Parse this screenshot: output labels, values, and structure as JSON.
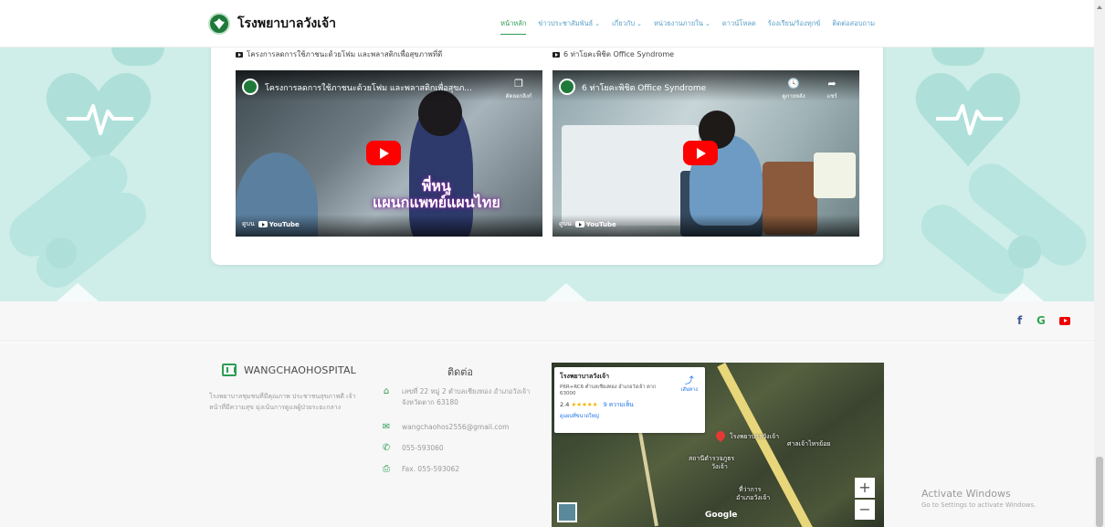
{
  "header": {
    "logo_text": "โรงพยาบาลวังเจ้า",
    "nav": [
      {
        "label": "หน้าหลัก",
        "active": true,
        "dropdown": false
      },
      {
        "label": "ข่าวประชาสัมพันธ์",
        "active": false,
        "dropdown": true
      },
      {
        "label": "เกี่ยวกับ",
        "active": false,
        "dropdown": true
      },
      {
        "label": "หน่วยงานภายใน",
        "active": false,
        "dropdown": true
      },
      {
        "label": "ดาวน์โหลด",
        "active": false,
        "dropdown": false
      },
      {
        "label": "ร้องเรียน/ร้องทุกข์",
        "active": false,
        "dropdown": false
      },
      {
        "label": "ติดต่อสอบถาม",
        "active": false,
        "dropdown": false
      }
    ]
  },
  "videos": [
    {
      "caption": "โครงการลดการใช้ภาชนะด้วยโฟม และพลาสติกเพื่อสุขภาพที่ดี",
      "title": "โครงการลดการใช้ภาชนะด้วยโฟม และพลาสติกเพื่อสุขภ...",
      "action_label": "คัดลอกลิงก์",
      "overlay_line1": "พี่หนู",
      "overlay_line2": "แผนกแพทย์แผนไทย",
      "watch_on": "ดูบน",
      "youtube": "YouTube"
    },
    {
      "caption": "6 ท่าโยคะพิชิต Office Syndrome",
      "title": "6 ท่าโยคะพิชิต Office Syndrome",
      "action_later": "ดูภายหลัง",
      "action_share": "แชร์",
      "watch_on": "ดูบน",
      "youtube": "YouTube"
    }
  ],
  "social": [
    {
      "icon": "facebook-icon",
      "glyph": "f"
    },
    {
      "icon": "google-icon",
      "glyph": "G"
    },
    {
      "icon": "youtube-icon",
      "glyph": ""
    }
  ],
  "footer": {
    "brand": "WANGCHAOHOSPITAL",
    "about": "โรงพยาบาลชุมชนที่มีคุณภาพ ประชาชนสุขภาพดี เจ้าหน้าที่มีความสุข มุ่งเน้นการดูแลผู้ป่วยระยะกลาง",
    "contact_title": "ติดต่อ",
    "address": "เลขที่ 22 หมู่ 2 ตำบลเชียงทอง อำเภอวังเจ้า จังหวัดตาก 63180",
    "email": "wangchaohos2556@gmail.com",
    "phone": "055-593060",
    "fax": "Fax. 055-593062"
  },
  "map": {
    "place": "โรงพยาบาลวังเจ้า",
    "address": "P6R+RC6 ตำบลเชียงทอง อำเภอวังเจ้า ตาก 63000",
    "directions": "เส้นทาง",
    "rating": "2.4",
    "stars": "★★★★★",
    "reviews": "9 ความเห็น",
    "larger_map": "ดูแผนที่ขนาดใหญ่",
    "pin_label": "โรงพยาบาลวังเจ้า",
    "label_station": "สถานีตำรวจภูธร",
    "label_station2": "วังเจ้า",
    "label_shrine": "ศาลเจ้าไทรย้อย",
    "label_district": "ที่ว่าการ",
    "label_district2": "อำเภอวังเจ้า",
    "zoom_in": "+",
    "zoom_out": "−",
    "google": "Google"
  },
  "activate": {
    "title": "Activate Windows",
    "subtitle": "Go to Settings to activate Windows."
  }
}
